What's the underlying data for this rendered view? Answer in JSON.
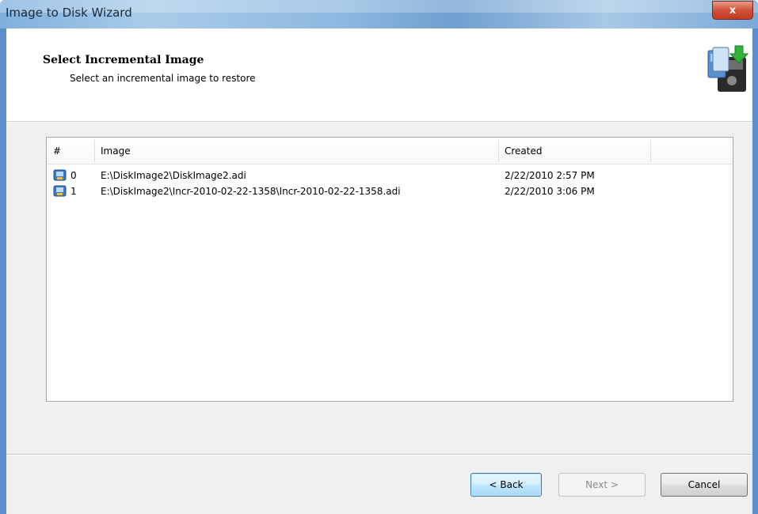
{
  "window": {
    "title": "Image to Disk Wizard",
    "close_label": "x"
  },
  "header": {
    "title": "Select Incremental Image",
    "subtitle": "Select an incremental image to restore",
    "icon": "disk-restore-icon"
  },
  "list": {
    "columns": [
      "#",
      "Image",
      "Created"
    ],
    "rows": [
      {
        "num": "0",
        "image": "E:\\DiskImage2\\DiskImage2.adi",
        "created": "2/22/2010 2:57 PM",
        "icon": "disk-image-icon"
      },
      {
        "num": "1",
        "image": "E:\\DiskImage2\\Incr-2010-02-22-1358\\Incr-2010-02-22-1358.adi",
        "created": "2/22/2010 3:06 PM",
        "icon": "disk-image-icon"
      }
    ]
  },
  "buttons": {
    "back": "< Back",
    "next": "Next >",
    "cancel": "Cancel"
  },
  "colors": {
    "title_bar": "#7fb0dd",
    "close_button": "#c23a22",
    "dialog_bg": "#f0f0f0",
    "disabled_text": "#8a8a8a"
  }
}
